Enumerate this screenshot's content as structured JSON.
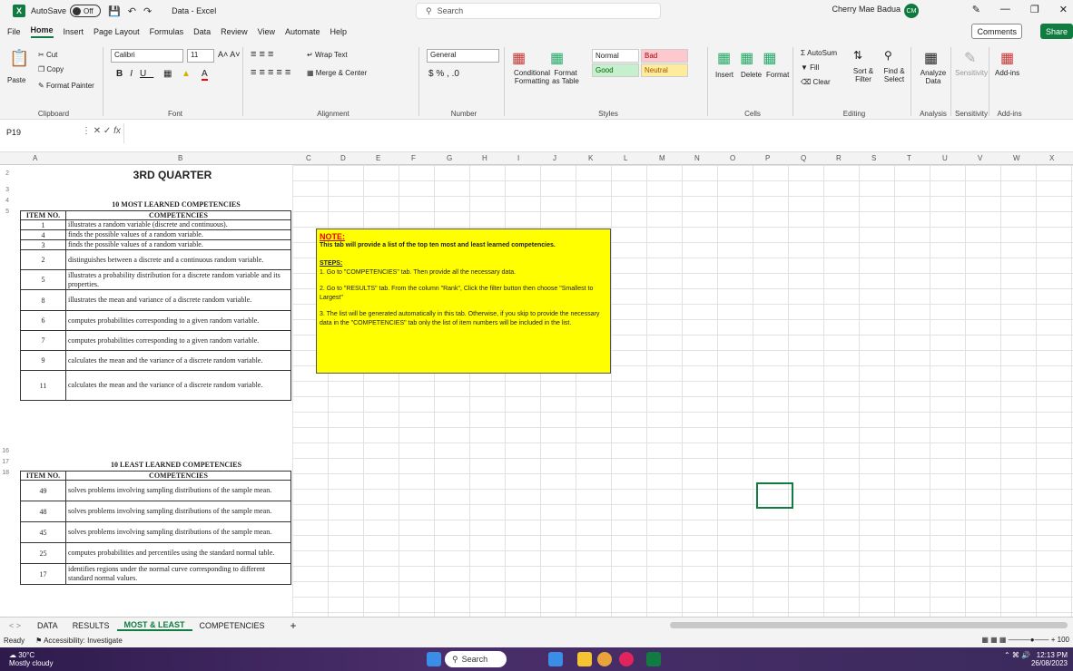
{
  "titlebar": {
    "autosave": "AutoSave",
    "toggle": "Off",
    "filename": "Data - Excel",
    "search": "Search",
    "user": "Cherry Mae Badua",
    "initials": "CM"
  },
  "menu": [
    "File",
    "Home",
    "Insert",
    "Page Layout",
    "Formulas",
    "Data",
    "Review",
    "View",
    "Automate",
    "Help"
  ],
  "menu_buttons": {
    "comments": "Comments",
    "share": "Share"
  },
  "ribbon": {
    "clipboard": {
      "paste": "Paste",
      "cut": "Cut",
      "copy": "Copy",
      "format_painter": "Format Painter",
      "label": "Clipboard"
    },
    "font": {
      "name": "Calibri",
      "size": "11",
      "label": "Font"
    },
    "alignment": {
      "wrap": "Wrap Text",
      "merge": "Merge & Center",
      "label": "Alignment"
    },
    "number": {
      "format": "General",
      "label": "Number"
    },
    "styles": {
      "conditional": "Conditional Formatting",
      "format_as": "Format as Table",
      "normal": "Normal",
      "bad": "Bad",
      "good": "Good",
      "neutral": "Neutral",
      "label": "Styles"
    },
    "cells": {
      "insert": "Insert",
      "delete": "Delete",
      "format": "Format",
      "label": "Cells"
    },
    "editing": {
      "autosum": "AutoSum",
      "fill": "Fill",
      "clear": "Clear",
      "sort": "Sort & Filter",
      "find": "Find & Select",
      "label": "Editing"
    },
    "analysis": {
      "analyze": "Analyze Data",
      "label": "Analysis"
    },
    "sensitivity": {
      "btn": "Sensitivity",
      "label": "Sensitivity"
    },
    "addins": {
      "btn": "Add-ins",
      "label": "Add-ins"
    }
  },
  "formula": {
    "cell": "P19",
    "fx": "fx"
  },
  "columns": [
    "A",
    "B",
    "C",
    "D",
    "E",
    "F",
    "G",
    "H",
    "I",
    "J",
    "K",
    "L",
    "M",
    "N",
    "O",
    "P",
    "Q",
    "R",
    "S",
    "T",
    "U",
    "V",
    "W",
    "X"
  ],
  "sheet": {
    "title": "3RD QUARTER",
    "most_title": "10 MOST LEARNED COMPETENCIES",
    "least_title": "10 LEAST LEARNED COMPETENCIES",
    "col_item": "ITEM NO.",
    "col_comp": "COMPETENCIES",
    "most": [
      {
        "no": "1",
        "text": "illustrates a random variable (discrete and continuous)."
      },
      {
        "no": "4",
        "text": "finds the possible values of a random variable."
      },
      {
        "no": "3",
        "text": "finds the possible values of a random variable."
      },
      {
        "no": "2",
        "text": "distinguishes between a discrete and a continuous random variable."
      },
      {
        "no": "5",
        "text": "illustrates a probability distribution for a discrete random variable and its properties."
      },
      {
        "no": "8",
        "text": "illustrates the mean and variance of a discrete random variable."
      },
      {
        "no": "6",
        "text": "computes probabilities corresponding to a given random variable."
      },
      {
        "no": "7",
        "text": "computes probabilities corresponding to a given random variable."
      },
      {
        "no": "9",
        "text": "calculates the mean and the variance of a discrete random variable."
      },
      {
        "no": "11",
        "text": "calculates the mean and the variance of a discrete random variable."
      }
    ],
    "least": [
      {
        "no": "49",
        "text": "solves problems involving sampling distributions of the sample mean."
      },
      {
        "no": "48",
        "text": "solves problems involving sampling distributions of the sample mean."
      },
      {
        "no": "45",
        "text": "solves problems involving sampling distributions of the sample mean."
      },
      {
        "no": "25",
        "text": "computes probabilities and percentiles using the standard normal table."
      },
      {
        "no": "17",
        "text": "identifies regions under the normal curve corresponding to different standard normal values."
      }
    ],
    "note": {
      "heading": "NOTE:",
      "intro": "This tab will provide a list of the top ten most and least learned competencies.",
      "steps": "STEPS:",
      "s1": "1. Go to \"COMPETENCIES\" tab. Then provide all the necessary data.",
      "s2": "2. Go to  \"RESULTS\" tab. From the column \"Rank\", Click the filter button  then choose \"Smallest to Largest\"",
      "s3": "3. The list  will be generated automatically in this tab.  Otherwise, if you skip to provide the necessary data in the \"COMPETENCIES\" tab only the list of item numbers will be included in the list."
    }
  },
  "tabs": [
    "DATA",
    "RESULTS",
    "MOST & LEAST",
    "COMPETENCIES"
  ],
  "status": {
    "ready": "Ready",
    "accessibility": "Accessibility: Investigate",
    "zoom": "100"
  },
  "taskbar": {
    "temp": "30°C",
    "weather": "Mostly cloudy",
    "search": "Search",
    "time": "12:13 PM",
    "date": "26/08/2023"
  }
}
